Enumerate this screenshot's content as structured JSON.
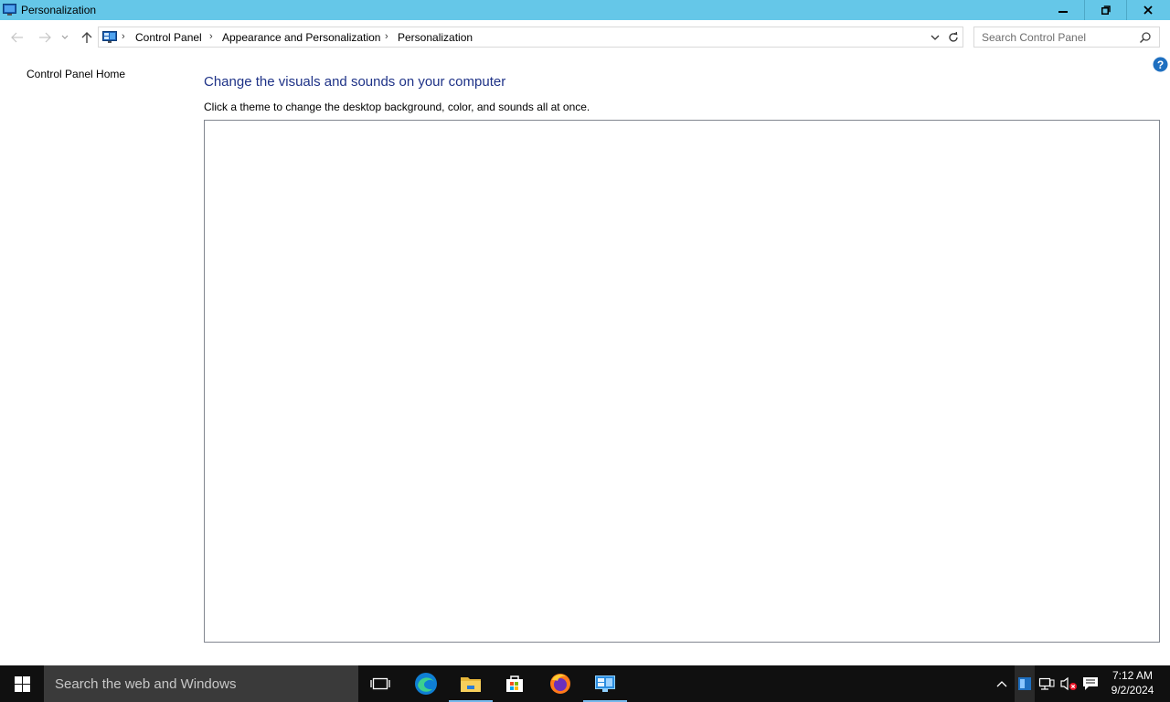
{
  "window": {
    "title": "Personalization"
  },
  "address_bar": {
    "breadcrumbs": [
      {
        "label": "Control Panel"
      },
      {
        "label": "Appearance and Personalization"
      },
      {
        "label": "Personalization"
      }
    ]
  },
  "search": {
    "placeholder": "Search Control Panel"
  },
  "sidebar": {
    "home_link": "Control Panel Home"
  },
  "main": {
    "title": "Change the visuals and sounds on your computer",
    "description": "Click a theme to change the desktop background, color, and sounds all at once."
  },
  "taskbar": {
    "search_placeholder": "Search the web and Windows",
    "apps": [
      {
        "name": "task-view",
        "icon": "task-view-icon",
        "active": false
      },
      {
        "name": "edge",
        "icon": "edge-icon",
        "active": false
      },
      {
        "name": "file-explorer",
        "icon": "folder-icon",
        "active": true
      },
      {
        "name": "store",
        "icon": "store-icon",
        "active": false
      },
      {
        "name": "firefox",
        "icon": "firefox-icon",
        "active": false
      },
      {
        "name": "control-panel",
        "icon": "control-panel-icon",
        "active": true
      }
    ],
    "clock": {
      "time": "7:12 AM",
      "date": "9/2/2024"
    }
  },
  "colors": {
    "titlebar": "#65c7e8",
    "heading": "#1e3287",
    "taskbar": "#101010",
    "taskbar_search": "#3a3a3a",
    "active_indicator": "#76b9ed",
    "help_icon": "#1e6fc0"
  }
}
